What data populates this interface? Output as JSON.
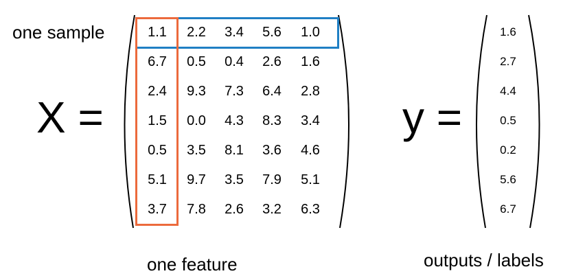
{
  "labels": {
    "one_sample": "one sample",
    "one_feature": "one feature",
    "outputs": "outputs / labels",
    "x_eq": "X =",
    "y_eq": "y ="
  },
  "colors": {
    "sample_box": "#1f7fc4",
    "feature_box": "#ec6a3c",
    "paren": "#000000"
  },
  "X": [
    [
      "1.1",
      "2.2",
      "3.4",
      "5.6",
      "1.0"
    ],
    [
      "6.7",
      "0.5",
      "0.4",
      "2.6",
      "1.6"
    ],
    [
      "2.4",
      "9.3",
      "7.3",
      "6.4",
      "2.8"
    ],
    [
      "1.5",
      "0.0",
      "4.3",
      "8.3",
      "3.4"
    ],
    [
      "0.5",
      "3.5",
      "8.1",
      "3.6",
      "4.6"
    ],
    [
      "5.1",
      "9.7",
      "3.5",
      "7.9",
      "5.1"
    ],
    [
      "3.7",
      "7.8",
      "2.6",
      "3.2",
      "6.3"
    ]
  ],
  "y": [
    "1.6",
    "2.7",
    "4.4",
    "0.5",
    "0.2",
    "5.6",
    "6.7"
  ]
}
